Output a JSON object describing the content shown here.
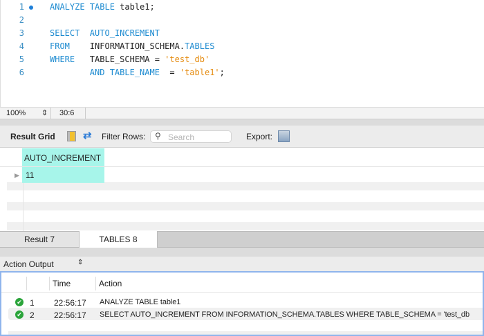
{
  "editor": {
    "lines": [
      {
        "n": "1",
        "marker": true,
        "tokens": [
          {
            "t": "ANALYZE TABLE ",
            "c": "kw"
          },
          {
            "t": "table1;",
            "c": "id"
          }
        ]
      },
      {
        "n": "2",
        "marker": false,
        "tokens": []
      },
      {
        "n": "3",
        "marker": false,
        "tokens": [
          {
            "t": "SELECT  AUTO_INCREMENT",
            "c": "kw"
          }
        ]
      },
      {
        "n": "4",
        "marker": false,
        "tokens": [
          {
            "t": "FROM    ",
            "c": "kw"
          },
          {
            "t": "INFORMATION_SCHEMA.",
            "c": "id"
          },
          {
            "t": "TABLES",
            "c": "kw"
          }
        ]
      },
      {
        "n": "5",
        "marker": false,
        "tokens": [
          {
            "t": "WHERE   ",
            "c": "kw"
          },
          {
            "t": "TABLE_SCHEMA = ",
            "c": "id"
          },
          {
            "t": "'test_db'",
            "c": "str"
          }
        ]
      },
      {
        "n": "6",
        "marker": false,
        "tokens": [
          {
            "t": "        AND TABLE_NAME",
            "c": "kw"
          },
          {
            "t": "  = ",
            "c": "id"
          },
          {
            "t": "'table1'",
            "c": "str"
          },
          {
            "t": ";",
            "c": "id"
          }
        ]
      }
    ]
  },
  "status": {
    "zoom": "100%",
    "position": "30:6"
  },
  "toolbar": {
    "result_grid": "Result Grid",
    "filter_label": "Filter Rows:",
    "search_placeholder": "Search",
    "export_label": "Export:"
  },
  "grid": {
    "columns": [
      "AUTO_INCREMENT"
    ],
    "rows": [
      [
        "11"
      ]
    ]
  },
  "tabs": [
    {
      "label": "Result 7",
      "active": false
    },
    {
      "label": "TABLES 8",
      "active": true
    }
  ],
  "output": {
    "selector": "Action Output",
    "headers": [
      "Time",
      "Action"
    ],
    "rows": [
      {
        "n": "1",
        "time": "22:56:17",
        "action": "ANALYZE TABLE table1"
      },
      {
        "n": "2",
        "time": "22:56:17",
        "action": "SELECT  AUTO_INCREMENT FROM   INFORMATION_SCHEMA.TABLES WHERE  TABLE_SCHEMA = 'test_db"
      }
    ]
  }
}
